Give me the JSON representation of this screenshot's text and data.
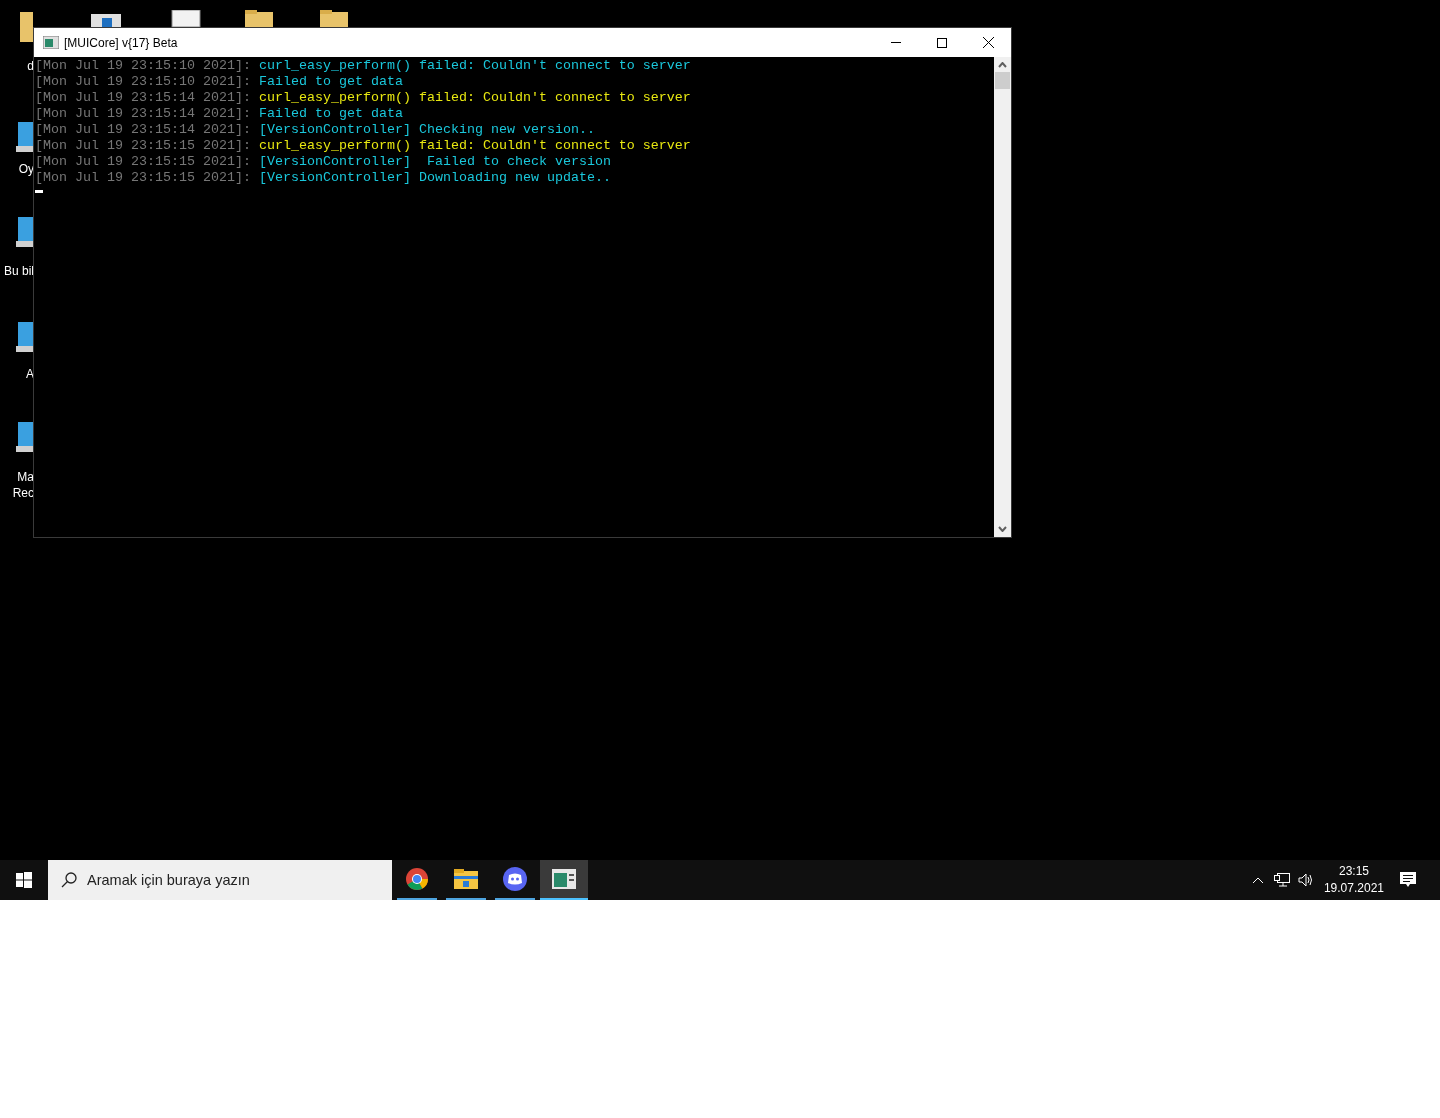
{
  "desktop_icons": [
    {
      "lines": [
        "d"
      ]
    },
    {
      "lines": [
        "Oy"
      ]
    },
    {
      "lines": [
        "Bu bil"
      ]
    },
    {
      "lines": [
        "A"
      ]
    },
    {
      "lines": [
        "Ma",
        "Rec"
      ]
    }
  ],
  "window": {
    "title": "[MUICore] v{17} Beta",
    "console": {
      "lines": [
        {
          "timestamp": "[Mon Jul 19 23:15:10 2021]:",
          "message": "curl_easy_perform() failed: Couldn't connect to server",
          "color": "#1ac8dc"
        },
        {
          "timestamp": "[Mon Jul 19 23:15:10 2021]:",
          "message": "Failed to get data",
          "color": "#1ac8dc"
        },
        {
          "timestamp": "[Mon Jul 19 23:15:14 2021]:",
          "message": "curl_easy_perform() failed: Couldn't connect to server",
          "color": "#e8e810"
        },
        {
          "timestamp": "[Mon Jul 19 23:15:14 2021]:",
          "message": "Failed to get data",
          "color": "#1ac8dc"
        },
        {
          "timestamp": "[Mon Jul 19 23:15:14 2021]:",
          "message": "[VersionController] Checking new version..",
          "color": "#1ac8dc"
        },
        {
          "timestamp": "[Mon Jul 19 23:15:15 2021]:",
          "message": "curl_easy_perform() failed: Couldn't connect to server",
          "color": "#e8e810"
        },
        {
          "timestamp": "[Mon Jul 19 23:15:15 2021]:",
          "message": "[VersionController]  Failed to check version",
          "color": "#1ac8dc"
        },
        {
          "timestamp": "[Mon Jul 19 23:15:15 2021]:",
          "message": "[VersionController] Downloading new update..",
          "color": "#1ac8dc"
        }
      ]
    }
  },
  "taskbar": {
    "search": {
      "placeholder": "Aramak için buraya yazın"
    },
    "apps": [
      {
        "kind": "browser",
        "selected": false
      },
      {
        "kind": "folder",
        "selected": false
      },
      {
        "kind": "chat",
        "selected": false
      },
      {
        "kind": "console",
        "selected": true
      }
    ],
    "clock": {
      "time": "23:15",
      "date": "19.07.2021"
    }
  }
}
